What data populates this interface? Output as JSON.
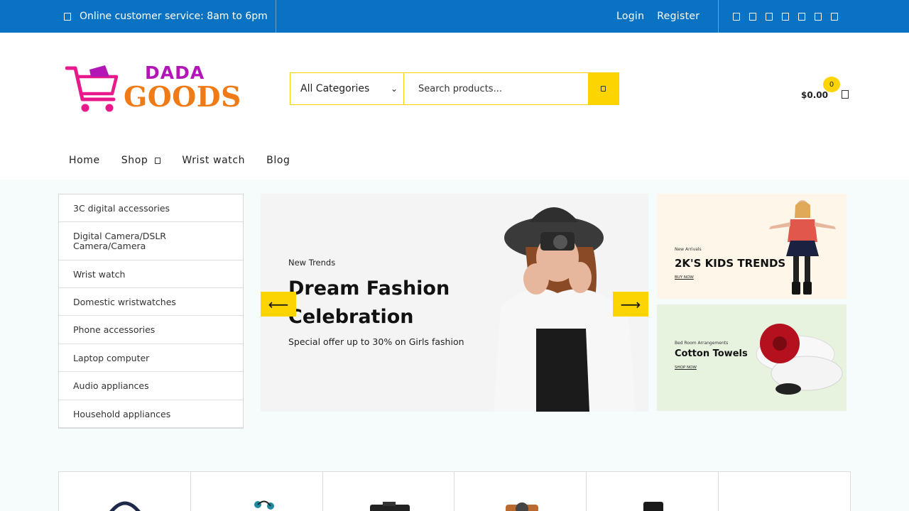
{
  "topbar": {
    "service_text": "Online customer service: 8am to 6pm",
    "login": "Login",
    "register": "Register",
    "social_icons": [
      "facebook-icon",
      "twitter-icon",
      "instagram-icon",
      "linkedin-icon",
      "pinterest-icon",
      "youtube-icon",
      "rss-icon"
    ]
  },
  "brand": {
    "line1": "DADA",
    "line2": "GOODS",
    "top_color": "#b316b7",
    "bottom_color": "#f07a16",
    "cart_color": "#e8198b"
  },
  "search": {
    "category": "All Categories",
    "placeholder": "Search products..."
  },
  "cart": {
    "count": "0",
    "amount": "$0.00"
  },
  "nav": {
    "home": "Home",
    "shop": "Shop",
    "wrist": "Wrist watch",
    "blog": "Blog"
  },
  "categories": [
    "3C digital accessories",
    "Digital Camera/DSLR Camera/Camera",
    "Wrist watch",
    "Domestic wristwatches",
    "Phone accessories",
    "Laptop computer",
    "Audio appliances",
    "Household appliances"
  ],
  "hero": {
    "kicker": "New Trends",
    "title": "Dream Fashion Celebration",
    "offer": "Special offer up to 30% on Girls fashion",
    "prev": "⟵",
    "next": "⟶"
  },
  "promos": {
    "kids": {
      "small": "New Arrivals",
      "big": "2K'S KIDS TRENDS",
      "link": "BUY NOW"
    },
    "towels": {
      "small": "Bed Room Arrangements",
      "big": "Cotton Towels",
      "link": "SHOP NOW"
    }
  },
  "colors": {
    "topbar": "#0a72c2",
    "accent": "#fcd500"
  }
}
